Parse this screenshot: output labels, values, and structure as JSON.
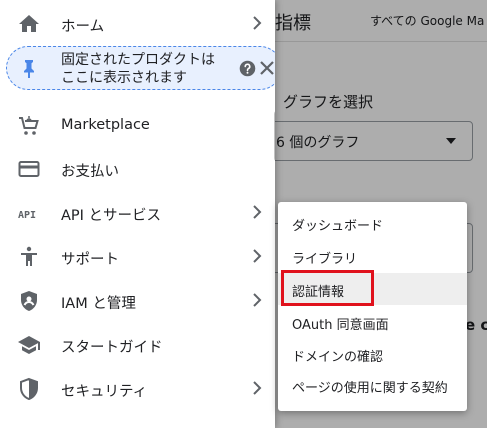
{
  "background": {
    "title": "指標",
    "breadcrumb": "すべての Google Ma",
    "select_label": "グラフを選択",
    "select_value": "6 個のグラフ",
    "bold_text": "e co"
  },
  "sidenav": {
    "items": [
      {
        "label": "ホーム",
        "icon": "home-icon",
        "chevron": true
      },
      {
        "label": "Marketplace",
        "icon": "cart-icon",
        "chevron": false
      },
      {
        "label": "お支払い",
        "icon": "billing-icon",
        "chevron": false
      },
      {
        "label": "API とサービス",
        "icon": "api-icon",
        "chevron": true
      },
      {
        "label": "サポート",
        "icon": "support-icon",
        "chevron": true
      },
      {
        "label": "IAM と管理",
        "icon": "iam-shield-icon",
        "chevron": true
      },
      {
        "label": "スタートガイド",
        "icon": "graduation-cap-icon",
        "chevron": false
      },
      {
        "label": "セキュリティ",
        "icon": "security-shield-icon",
        "chevron": true
      }
    ],
    "pin_notice": {
      "line1": "固定されたプロダクトは",
      "line2": "ここに表示されます"
    },
    "api_icon_text": "API"
  },
  "flyout_menu": {
    "items": [
      "ダッシュボード",
      "ライブラリ",
      "認証情報",
      "OAuth 同意画面",
      "ドメインの確認",
      "ページの使用に関する契約"
    ],
    "highlighted_index": 2
  },
  "colors": {
    "accent_blue": "#4a86e8",
    "pin_bg": "#e8f0fe",
    "highlight_red": "#e0111c",
    "icon_gray": "#5f6368"
  }
}
